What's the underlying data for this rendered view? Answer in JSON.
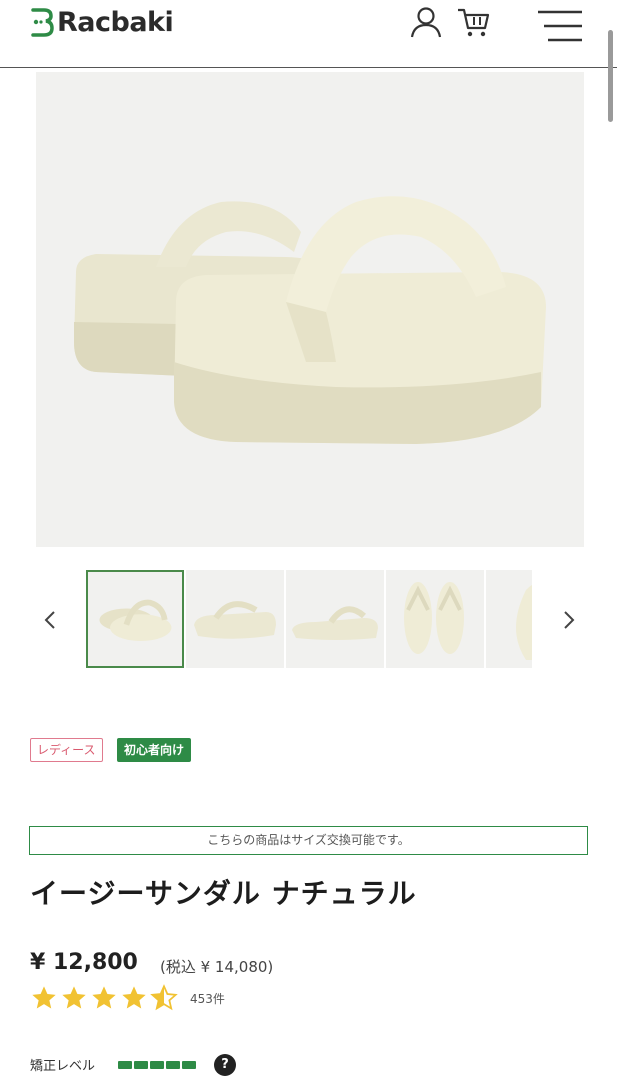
{
  "header": {
    "brand": "Racbaki",
    "icons": [
      "user-icon",
      "cart-icon",
      "hamburger-menu-icon"
    ]
  },
  "gallery": {
    "prev_icon": "chevron-left-icon",
    "next_icon": "chevron-right-icon",
    "thumbnail_count_visible": 5,
    "active_index": 0
  },
  "tags": {
    "ladies": "レディース",
    "beginner": "初心者向け"
  },
  "notice": "こちらの商品はサイズ交換可能です。",
  "product": {
    "title": "イージーサンダル ナチュラル",
    "price": "¥ 12,800",
    "price_tax": "(税込 ¥ 14,080)",
    "rating": 4.5,
    "reviews": "453件",
    "level_label": "矯正レベル",
    "level_value": 5,
    "level_max": 5,
    "help": "?"
  },
  "colors": {
    "brand_green": "#2e8b46",
    "star": "#f1c232",
    "ladies_pink": "#e07a8e"
  }
}
